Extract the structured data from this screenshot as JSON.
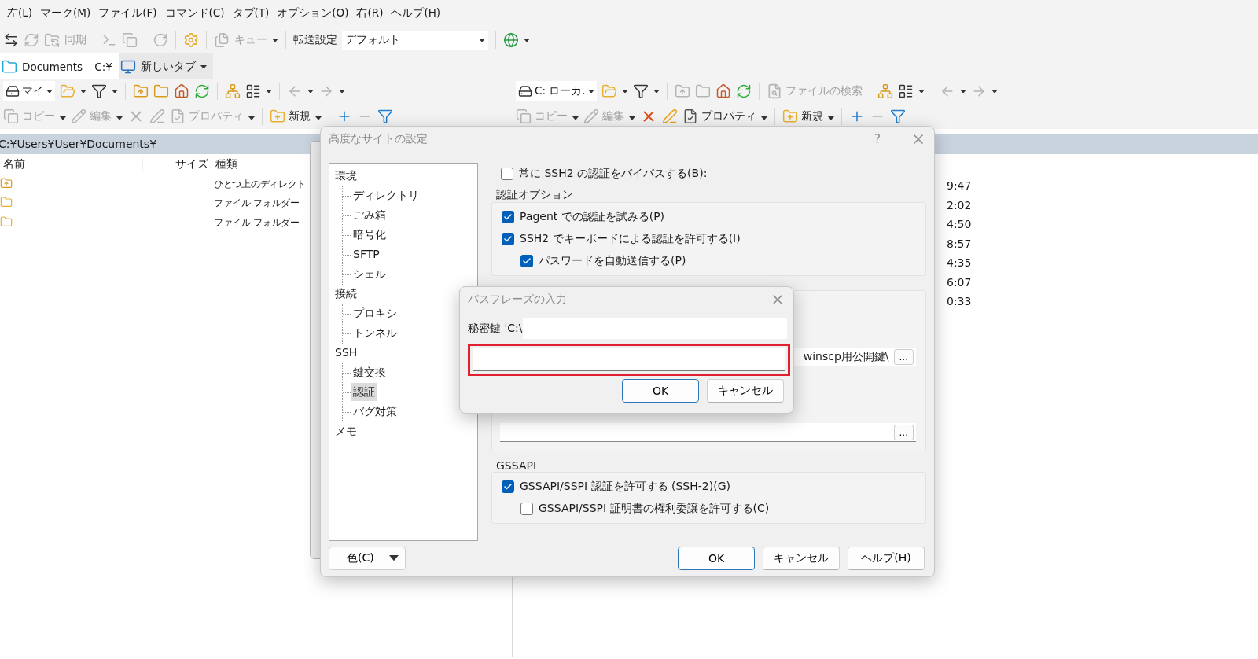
{
  "menu": [
    "左(L)",
    "マーク(M)",
    "ファイル(F)",
    "コマンド(C)",
    "タブ(T)",
    "オプション(O)",
    "右(R)",
    "ヘルプ(H)"
  ],
  "toolbar": {
    "sync": {
      "label": "同期",
      "disabled": true
    },
    "queue": {
      "label": "キュー",
      "disabled": true
    },
    "transfer_label": "転送設定",
    "transfer_preset": "デフォルト"
  },
  "tabs": [
    {
      "label": "Documents – C:¥",
      "selected": true
    },
    {
      "label": "新しいタブ",
      "selected": false
    }
  ],
  "left_panel": {
    "drive": "マイ",
    "delete": {
      "disabled": true
    },
    "commands": [
      {
        "label": "コピー",
        "disabled": true
      },
      {
        "label": "編集",
        "disabled": true
      },
      {
        "label": "プロパティ",
        "disabled": true
      },
      {
        "label": "新規",
        "disabled": false
      }
    ],
    "path": "C:¥Users¥User¥Documents¥",
    "columns": [
      "名前",
      "サイズ",
      "種類"
    ],
    "rows": [
      {
        "kind": "parent",
        "type": "ひとつ上のディレクト"
      },
      {
        "kind": "folder",
        "type": "ファイル フォルダー"
      },
      {
        "kind": "folder",
        "type": "ファイル フォルダー"
      }
    ]
  },
  "right_panel": {
    "drive": "C: ローカ.",
    "find": {
      "label": "ファイルの検索",
      "disabled": true
    },
    "delete": {
      "disabled": false
    },
    "commands": [
      {
        "label": "コピー",
        "disabled": true
      },
      {
        "label": "編集",
        "disabled": true
      },
      {
        "label": "プロパティ",
        "disabled": false
      },
      {
        "label": "新規",
        "disabled": false
      }
    ],
    "times": [
      "9:47",
      "2:02",
      "4:50",
      "8:57",
      "4:35",
      "6:07",
      "0:33"
    ]
  },
  "site_dialog": {
    "title": "高度なサイトの設定",
    "help": "?",
    "tree": [
      {
        "label": "環境",
        "selected": false,
        "children": [
          {
            "label": "ディレクトリ",
            "selected": false
          },
          {
            "label": "ごみ箱",
            "selected": false
          },
          {
            "label": "暗号化",
            "selected": false
          },
          {
            "label": "SFTP",
            "selected": false
          },
          {
            "label": "シェル",
            "selected": false
          }
        ]
      },
      {
        "label": "接続",
        "selected": false,
        "children": [
          {
            "label": "プロキシ",
            "selected": false
          },
          {
            "label": "トンネル",
            "selected": false
          }
        ]
      },
      {
        "label": "SSH",
        "selected": false,
        "children": [
          {
            "label": "鍵交換",
            "selected": false
          },
          {
            "label": "認証",
            "selected": true
          },
          {
            "label": "バグ対策",
            "selected": false
          }
        ]
      },
      {
        "label": "メモ",
        "selected": false
      }
    ],
    "bypass": {
      "label": "常に SSH2 の認証をバイパスする(B):",
      "checked": false
    },
    "auth_options": {
      "title": "認証オプション",
      "items": [
        {
          "label": "Pagent での認証を試みる(P)",
          "checked": true
        },
        {
          "label": "SSH2 でキーボードによる認証を許可する(I)",
          "checked": true,
          "children": [
            {
              "label": "パスワードを自動送信する(P)",
              "checked": true
            }
          ]
        }
      ]
    },
    "auth_fields": [
      {
        "value": "winscp用公開鍵\\",
        "browse": "..."
      },
      {
        "browse": "..."
      }
    ],
    "gssapi": {
      "title": "GSSAPI",
      "items": [
        {
          "label": "GSSAPI/SSPI 認証を許可する (SSH-2)(G)",
          "checked": true,
          "children": [
            {
              "label": "GSSAPI/SSPI 証明書の権利委譲を許可する(C)",
              "checked": false
            }
          ]
        }
      ]
    },
    "color_button": "色(C)",
    "buttons": [
      {
        "label": "OK",
        "default": true
      },
      {
        "label": "キャンセル",
        "default": false
      },
      {
        "label": "ヘルプ(H)",
        "default": false
      }
    ]
  },
  "passphrase_dialog": {
    "title": "パスフレーズの入力",
    "prompt": "秘密鍵 'C:\\",
    "buttons": [
      {
        "label": "OK",
        "default": true
      },
      {
        "label": "キャンセル",
        "default": false
      }
    ]
  }
}
